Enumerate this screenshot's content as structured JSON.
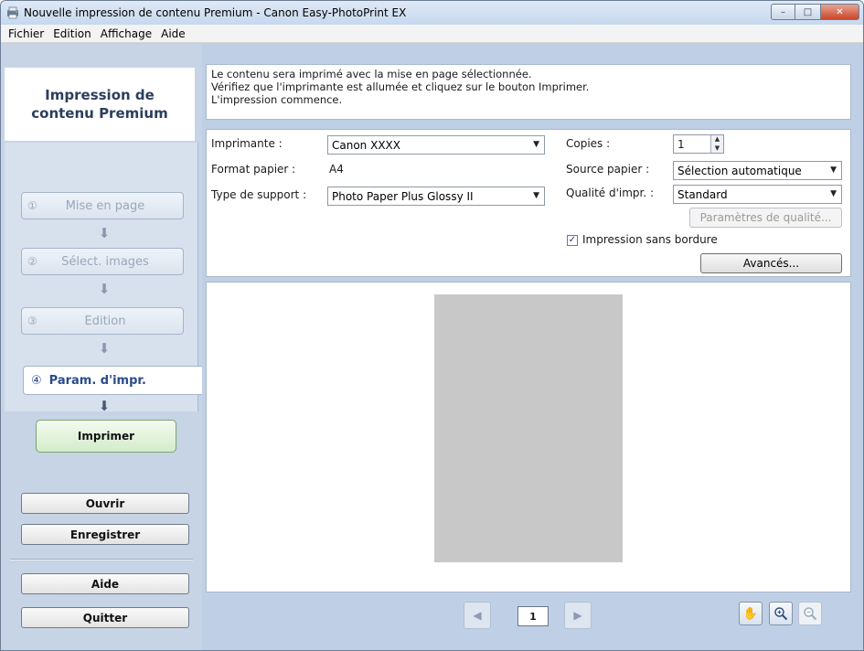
{
  "window": {
    "title": "Nouvelle impression de contenu Premium - Canon Easy-PhotoPrint EX",
    "controls": {
      "minimize": "–",
      "maximize": "□",
      "close": "✕"
    }
  },
  "menu": [
    "Fichier",
    "Edition",
    "Affichage",
    "Aide"
  ],
  "sidebar": {
    "header_line1": "Impression de",
    "header_line2": "contenu Premium",
    "steps": [
      {
        "num": "①",
        "label": "Mise en page"
      },
      {
        "num": "②",
        "label": "Sélect. images"
      },
      {
        "num": "③",
        "label": "Edition"
      }
    ],
    "active_step": {
      "num": "④",
      "label": "Param. d'impr."
    },
    "print_label": "Imprimer",
    "open_label": "Ouvrir",
    "save_label": "Enregistrer",
    "help_label": "Aide",
    "quit_label": "Quitter"
  },
  "message": {
    "line1": "Le contenu sera imprimé avec la mise en page sélectionnée.",
    "line2": "Vérifiez que l'imprimante est allumée et cliquez sur le bouton Imprimer.",
    "line3": "L'impression commence."
  },
  "settings": {
    "printer_label": "Imprimante :",
    "printer_value": "Canon XXXX",
    "paper_size_label": "Format papier :",
    "paper_size_value": "A4",
    "media_type_label": "Type de support :",
    "media_type_value": "Photo Paper Plus Glossy II",
    "copies_label": "Copies :",
    "copies_value": "1",
    "paper_source_label": "Source papier :",
    "paper_source_value": "Sélection automatique",
    "quality_label": "Qualité d'impr. :",
    "quality_value": "Standard",
    "quality_settings_label": "Paramètres de qualité...",
    "borderless_label": "Impression sans bordure",
    "borderless_checked": true,
    "advanced_label": "Avancés..."
  },
  "preview": {
    "page_number": "1"
  }
}
